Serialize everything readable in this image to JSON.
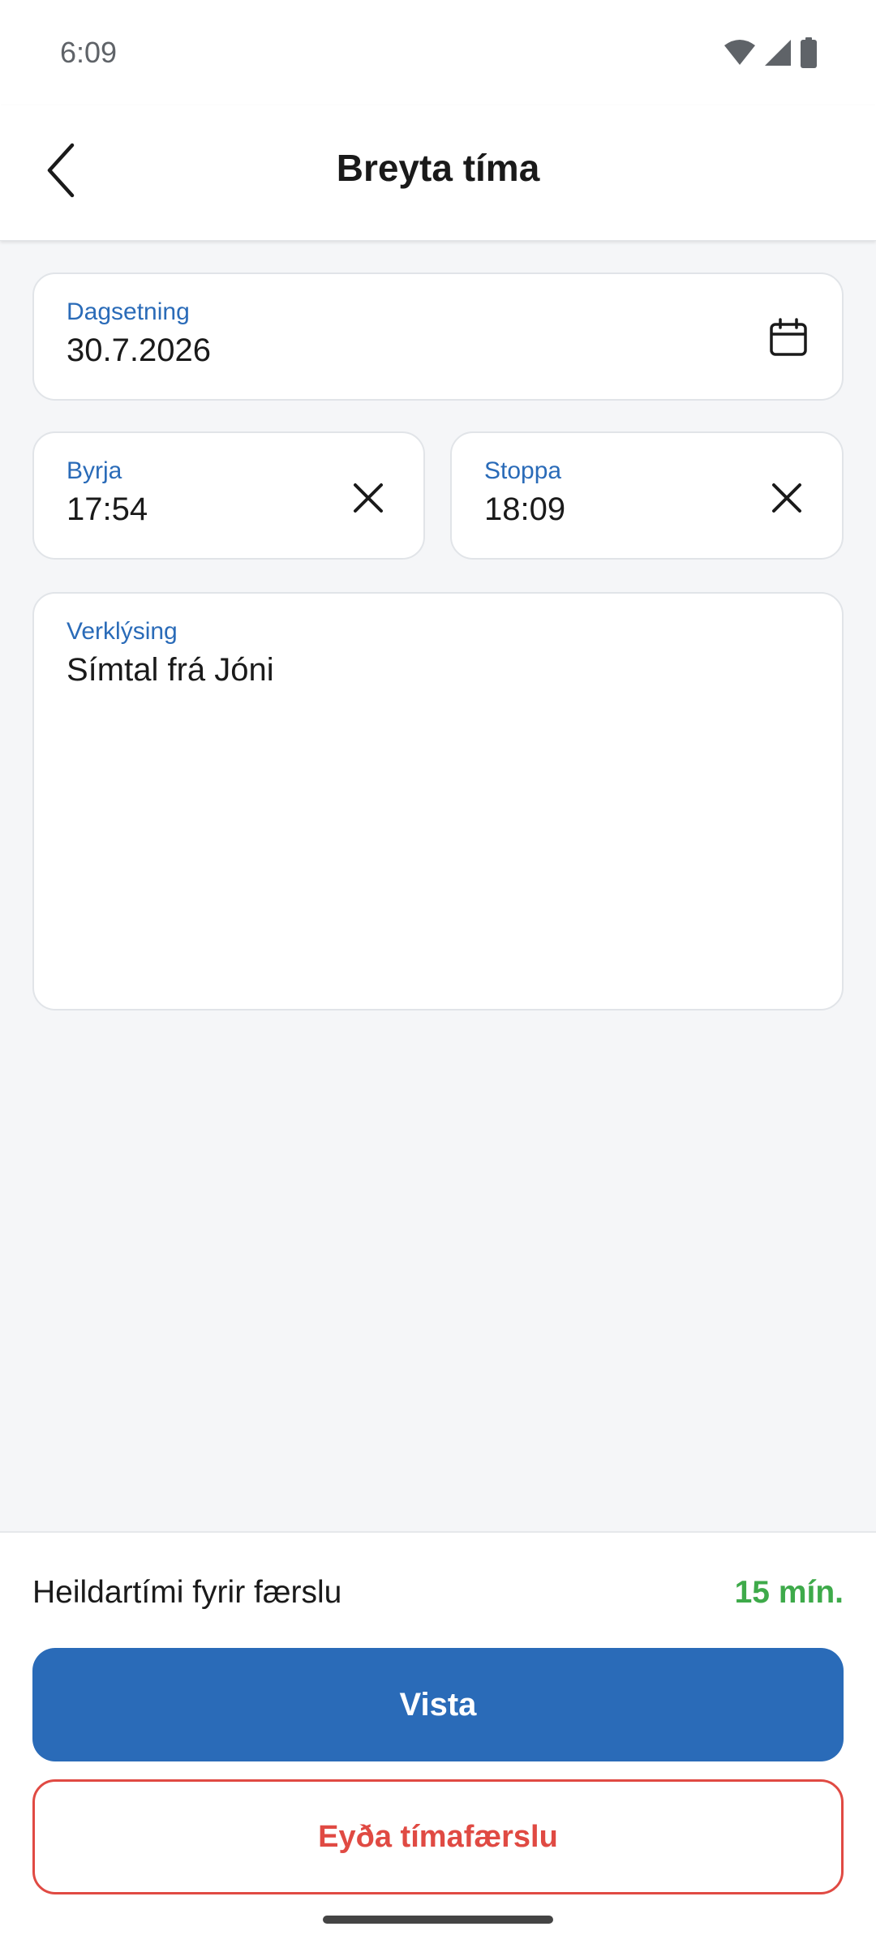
{
  "status_bar": {
    "time": "6:09",
    "icons": [
      "wifi-icon",
      "cellular-signal-icon",
      "battery-icon"
    ]
  },
  "header": {
    "title": "Breyta tíma",
    "back_icon": "chevron-left-icon"
  },
  "form": {
    "date": {
      "label": "Dagsetning",
      "value": "30.7.2026",
      "icon": "calendar-icon"
    },
    "start": {
      "label": "Byrja",
      "value": "17:54",
      "icon": "close-icon"
    },
    "stop": {
      "label": "Stoppa",
      "value": "18:09",
      "icon": "close-icon"
    },
    "description": {
      "label": "Verklýsing",
      "value": "Símtal frá Jóni"
    }
  },
  "footer": {
    "total_label": "Heildartími fyrir færslu",
    "total_value": "15 mín.",
    "save_label": "Vista",
    "delete_label": "Eyða tímafærslu"
  },
  "colors": {
    "accent": "#2a6bb8",
    "success": "#3eaa4a",
    "danger": "#e04a43",
    "background": "#f5f6f8"
  }
}
